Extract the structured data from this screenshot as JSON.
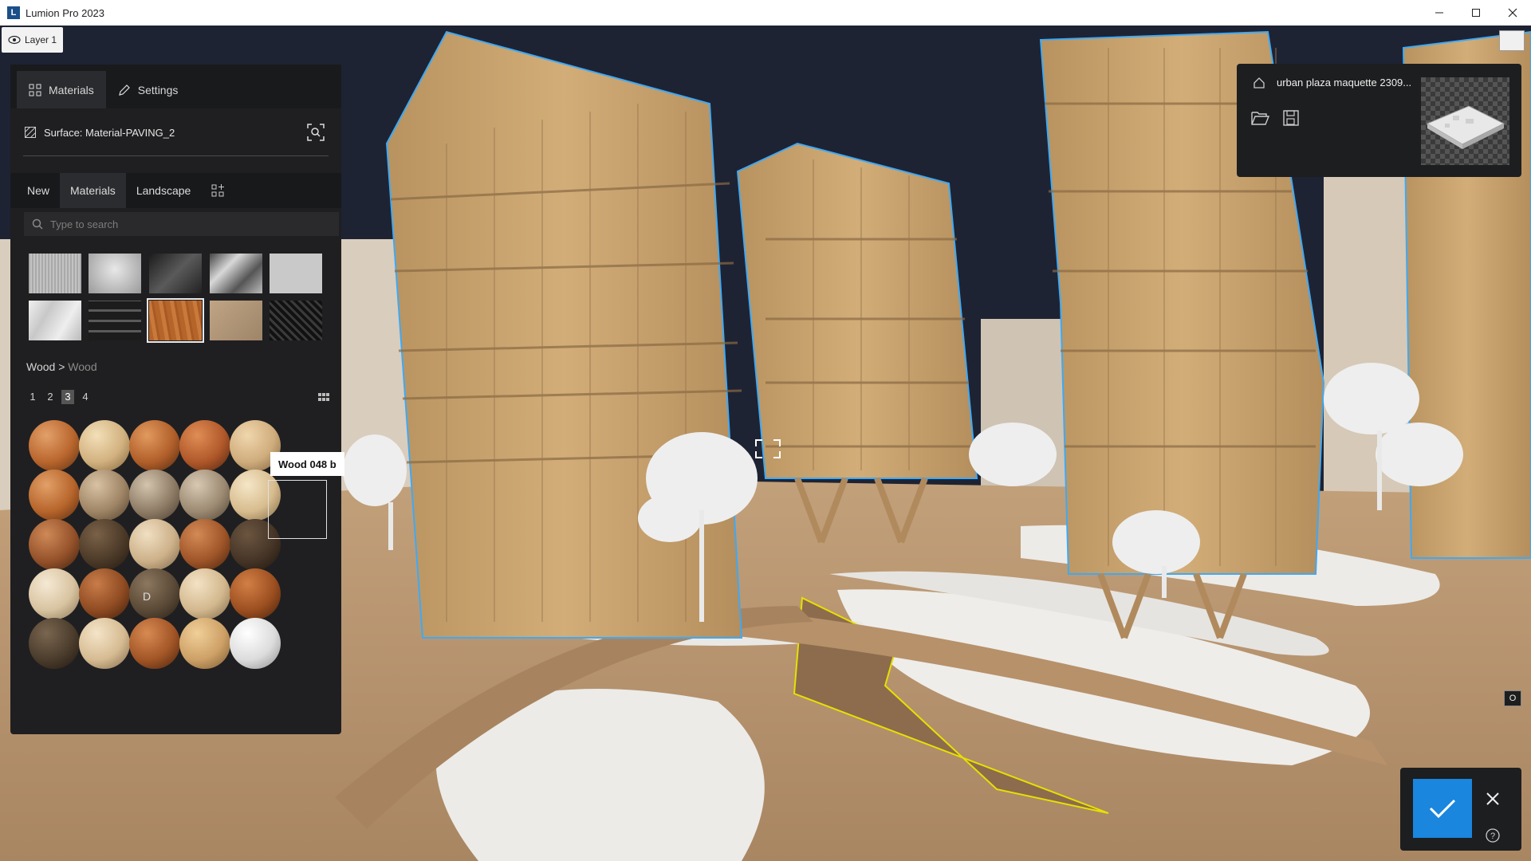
{
  "window": {
    "title": "Lumion Pro 2023",
    "controls": [
      "minimize-icon",
      "maximize-icon",
      "close-icon"
    ]
  },
  "layer": {
    "label": "Layer 1"
  },
  "panel": {
    "tabs": [
      {
        "label": "Materials",
        "icon": "grid-icon",
        "active": true
      },
      {
        "label": "Settings",
        "icon": "pencil-icon",
        "active": false
      }
    ],
    "surface_label": "Surface: Material-PAVING_2",
    "library_tabs": [
      {
        "label": "New",
        "active": false
      },
      {
        "label": "Materials",
        "active": true
      },
      {
        "label": "Landscape",
        "active": false
      }
    ],
    "search_placeholder": "Type to search",
    "breadcrumb": {
      "parent": "Wood",
      "separator": ">",
      "current": "Wood"
    },
    "pages": [
      "1",
      "2",
      "3",
      "4"
    ],
    "current_page": "3",
    "tooltip": "Wood 048 b",
    "marker": "D"
  },
  "project": {
    "name": "urban plaza maquette 2309..."
  },
  "viewport": {
    "small_badge": "O"
  },
  "colors": {
    "accent": "#1a86de",
    "panel_bg": "#1f1f21",
    "highlight_outline": "#3fa9f5",
    "selection_outline": "#e8e000"
  }
}
